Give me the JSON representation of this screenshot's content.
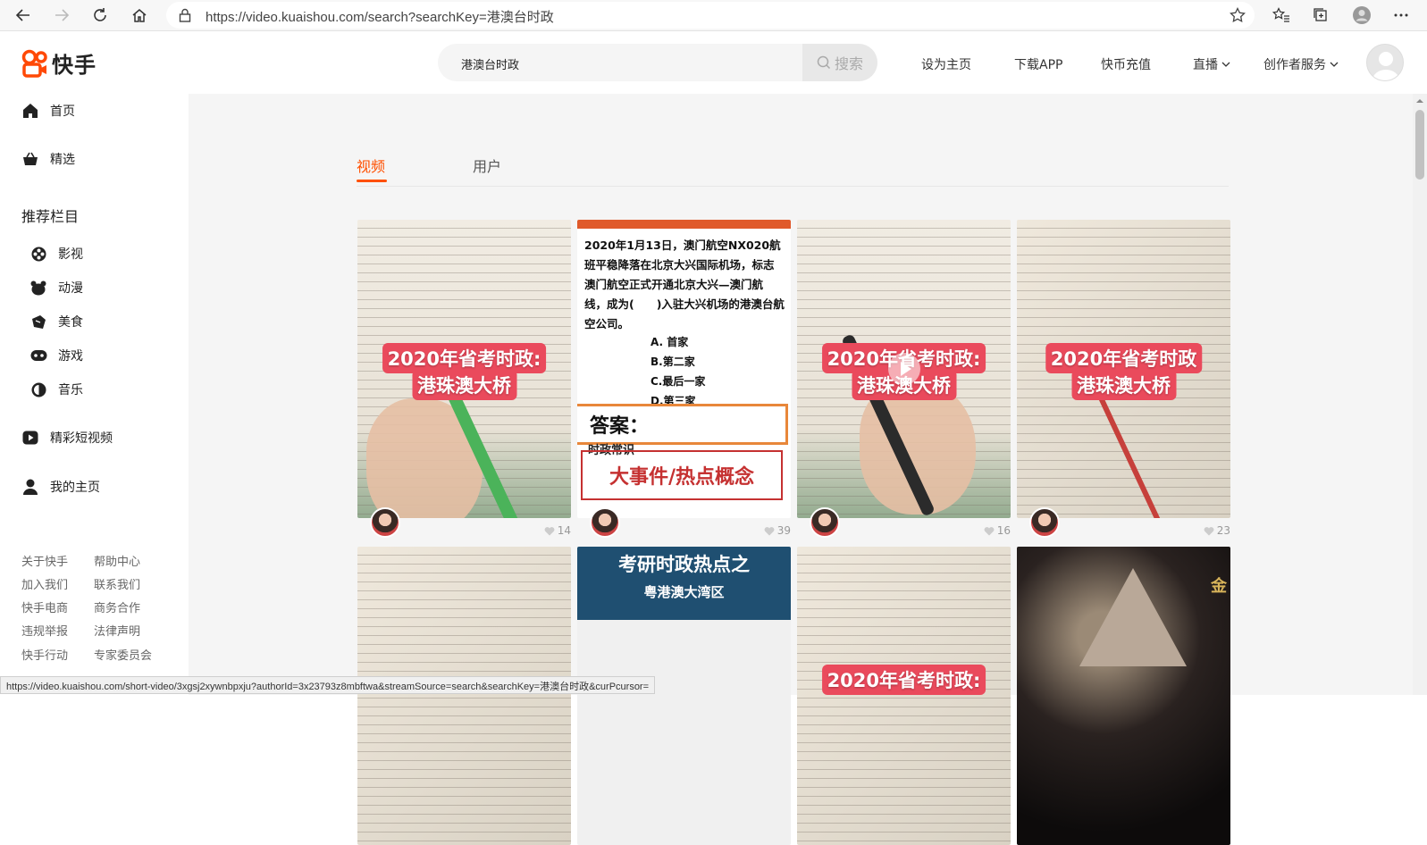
{
  "browser": {
    "url": "https://video.kuaishou.com/search?searchKey=港澳台时政",
    "status_url": "https://video.kuaishou.com/short-video/3xgsj2xywnbpxju?authorId=3x23793z8mbftwa&streamSource=search&searchKey=港澳台时政&curPcursor="
  },
  "header": {
    "logo_text": "快手",
    "search_value": "港澳台时政",
    "search_button": "搜索",
    "nav": [
      "设为主页",
      "下载APP",
      "快币充值",
      "直播",
      "创作者服务"
    ]
  },
  "sidebar": {
    "main_items": [
      {
        "label": "首页",
        "icon": "home-icon"
      },
      {
        "label": "精选",
        "icon": "basket-icon"
      }
    ],
    "section_title": "推荐栏目",
    "categories": [
      {
        "label": "影视",
        "icon": "film-reel-icon"
      },
      {
        "label": "动漫",
        "icon": "bear-icon"
      },
      {
        "label": "美食",
        "icon": "food-icon"
      },
      {
        "label": "游戏",
        "icon": "gamepad-icon"
      },
      {
        "label": "音乐",
        "icon": "music-disc-icon"
      }
    ],
    "bottom_items": [
      {
        "label": "精彩短视频",
        "icon": "play-video-icon"
      },
      {
        "label": "我的主页",
        "icon": "user-icon"
      }
    ],
    "footer_links": [
      "关于快手",
      "帮助中心",
      "加入我们",
      "联系我们",
      "快手电商",
      "商务合作",
      "违规举报",
      "法律声明",
      "快手行动",
      "专家委员会"
    ]
  },
  "tabs": [
    "视频",
    "用户"
  ],
  "cards": [
    {
      "caption1": "2020年省考时政:",
      "caption2": "港珠澳大桥",
      "likes": "14"
    },
    {
      "quiz_text": "2020年1月13日，澳门航空NX020航班平稳降落在北京大兴国际机场，标志澳门航空正式开通北京大兴—澳门航线，成为(　　)入驻大兴机场的港澳台航空公司。",
      "options": [
        "A. 首家",
        "B.第二家",
        "C.最后一家",
        "D.第三家"
      ],
      "answer_label": "答案：",
      "sub_label": "时政常识",
      "big_label": "大事件/热点概念",
      "likes": "39"
    },
    {
      "caption1": "2020年省考时政:",
      "caption2": "港珠澳大桥",
      "likes": "16"
    },
    {
      "caption1": "2020年省考时政",
      "caption2": "港珠澳大桥",
      "likes": "23"
    },
    {
      "kind": "book"
    },
    {
      "title1": "考研时政热点之",
      "title2": "粤港澳大湾区"
    },
    {
      "caption1": "2020年省考时政:"
    },
    {
      "gold_text": "金"
    }
  ]
}
